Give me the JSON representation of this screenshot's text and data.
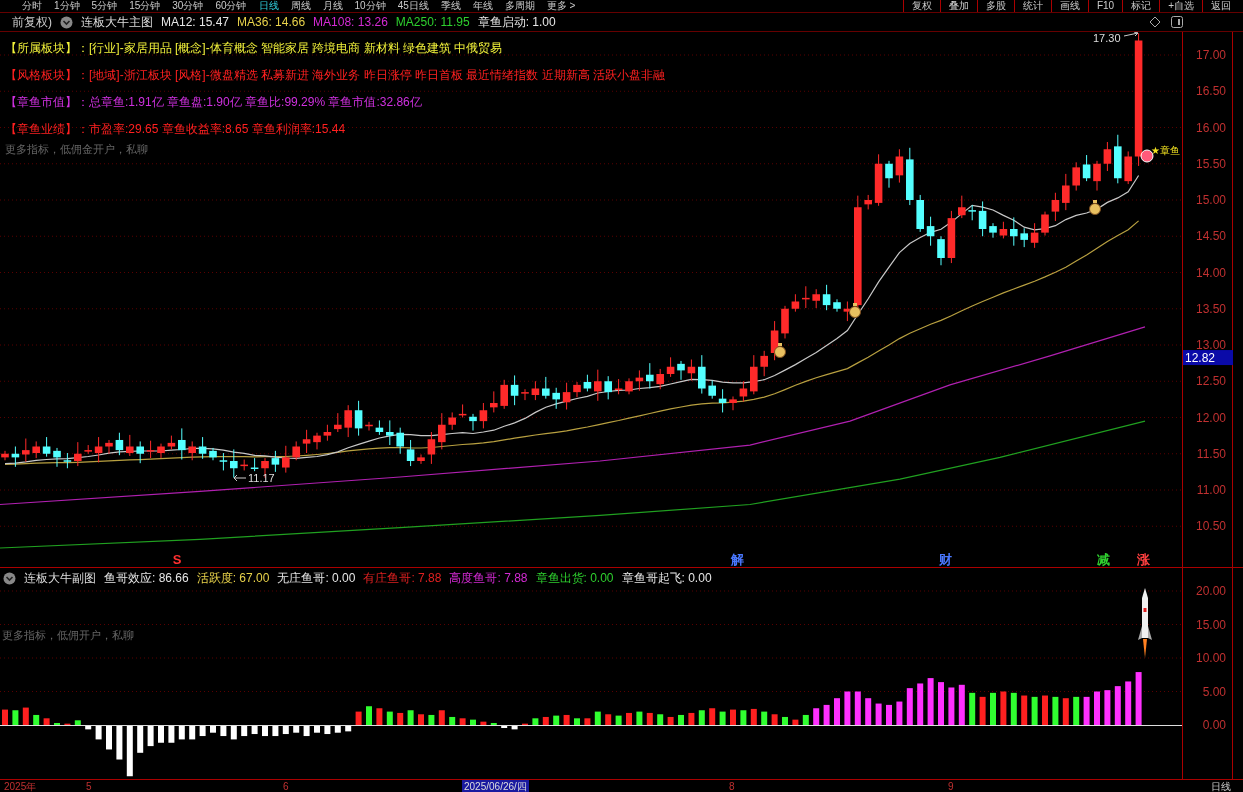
{
  "period_tabs": [
    {
      "label": "分时",
      "selected": false
    },
    {
      "label": "1分钟",
      "selected": false
    },
    {
      "label": "5分钟",
      "selected": false
    },
    {
      "label": "15分钟",
      "selected": false
    },
    {
      "label": "30分钟",
      "selected": false
    },
    {
      "label": "60分钟",
      "selected": false
    },
    {
      "label": "日线",
      "selected": true
    },
    {
      "label": "周线",
      "selected": false
    },
    {
      "label": "月线",
      "selected": false
    },
    {
      "label": "10分钟",
      "selected": false
    },
    {
      "label": "45日线",
      "selected": false
    },
    {
      "label": "季线",
      "selected": false
    },
    {
      "label": "年线",
      "selected": false
    },
    {
      "label": "多周期",
      "selected": false
    },
    {
      "label": "更多 >",
      "selected": false
    }
  ],
  "toolbar_buttons": [
    "复权",
    "叠加",
    "多股",
    "统计",
    "画线",
    "F10",
    "标记",
    "+自选",
    "返回"
  ],
  "main_header": {
    "adjust": "前复权)",
    "indicator": "连板大牛主图",
    "values": [
      {
        "text": "MA12: 15.47",
        "color": "#e6e6e6"
      },
      {
        "text": "MA36: 14.66",
        "color": "#e8d24a"
      },
      {
        "text": "MA108: 13.26",
        "color": "#d42ad4"
      },
      {
        "text": "MA250: 11.95",
        "color": "#2ed02e"
      },
      {
        "text": "章鱼启动: 1.00",
        "color": "#e6e6e6"
      }
    ]
  },
  "info_rows": [
    {
      "label": "【所属板块】：",
      "text": "[行业]-家居用品 [概念]-体育概念 智能家居 跨境电商 新材料 绿色建筑 中俄贸易",
      "color": "#f2f23a"
    },
    {
      "label": "【风格板块】：",
      "text": "[地域]-浙江板块 [风格]-微盘精选 私募新进 海外业务 昨日涨停 昨日首板 最近情绪指数 近期新高 活跃小盘非融",
      "color": "#ff2020"
    },
    {
      "label": "【章鱼市值】：",
      "text": "总章鱼:1.91亿 章鱼盘:1.90亿 章鱼比:99.29% 章鱼市值:32.86亿",
      "color": "#d030e0"
    },
    {
      "label": "【章鱼业绩】：",
      "text": "市盈率:29.65 章鱼收益率:8.65 章鱼利润率:15.44",
      "color": "#ff2020"
    }
  ],
  "promo_text": "更多指标，低佣金开户，私聊",
  "price_axis": [
    "17.00",
    "16.50",
    "16.00",
    "15.50",
    "15.00",
    "14.50",
    "14.00",
    "13.50",
    "13.00",
    "12.50",
    "12.00",
    "11.50",
    "11.00",
    "10.50"
  ],
  "current_price": "12.82",
  "annotations": {
    "high": "17.30",
    "low": "11.17",
    "signal": "★章鱼"
  },
  "event_markers": [
    {
      "label": "S",
      "color": "#ff3030"
    },
    {
      "label": "解",
      "color": "#4a78ff"
    },
    {
      "label": "财",
      "color": "#4a78ff"
    },
    {
      "label": "减",
      "color": "#30d030"
    },
    {
      "label": "涨",
      "color": "#ff4040"
    }
  ],
  "sub_header": {
    "indicator": "连板大牛副图",
    "values": [
      {
        "text": "鱼哥效应: 86.66",
        "color": "#e6e6e6"
      },
      {
        "text": "活跃度: 67.00",
        "color": "#e8d24a"
      },
      {
        "text": "无庄鱼哥: 0.00",
        "color": "#e6e6e6"
      },
      {
        "text": "有庄鱼哥: 7.88",
        "color": "#e02020"
      },
      {
        "text": "高度鱼哥: 7.88",
        "color": "#d42ad4"
      },
      {
        "text": "章鱼出货: 0.00",
        "color": "#2ed02e"
      },
      {
        "text": "章鱼哥起飞: 0.00",
        "color": "#e6e6e6"
      }
    ]
  },
  "sub_promo": "更多指标，低佣开户，私聊",
  "sub_axis": [
    "20.00",
    "15.00",
    "10.00",
    "5.00",
    "0.00"
  ],
  "date_axis": [
    {
      "label": "2025年",
      "selected": false
    },
    {
      "label": "5",
      "selected": false
    },
    {
      "label": "6",
      "selected": false
    },
    {
      "label": "2025/06/26/四",
      "selected": true
    },
    {
      "label": "8",
      "selected": false
    },
    {
      "label": "9",
      "selected": false
    }
  ],
  "period_label": "日线"
}
